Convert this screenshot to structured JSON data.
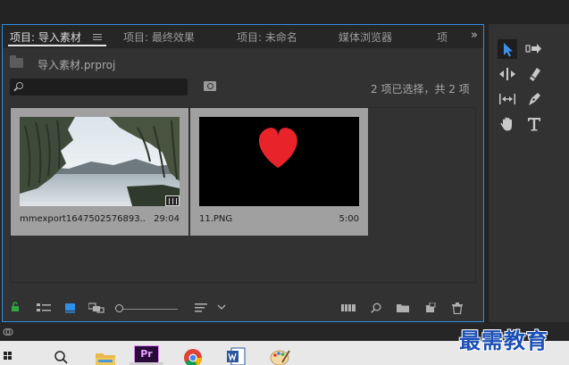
{
  "tabs": [
    {
      "label": "项目: 导入素材",
      "active": true
    },
    {
      "label": "项目: 最终效果",
      "active": false
    },
    {
      "label": "项目: 未命名",
      "active": false
    },
    {
      "label": "媒体浏览器",
      "active": false
    },
    {
      "label": "项",
      "active": false
    }
  ],
  "tabs_overflow": "»",
  "project": {
    "name": "导入素材.prproj"
  },
  "search": {
    "placeholder": ""
  },
  "selection_status": "2 项已选择，共 2 项",
  "items": [
    {
      "name": "mmexport1647502576893...",
      "duration": "29:04",
      "type": "video"
    },
    {
      "name": "11.PNG",
      "duration": "5:00",
      "type": "image"
    }
  ],
  "tools": [
    "selection-tool",
    "track-select-tool",
    "ripple-edit-tool",
    "razor-tool",
    "slip-tool",
    "pen-tool",
    "hand-tool",
    "type-tool"
  ],
  "colors": {
    "accent": "#2f8ee5",
    "heart": "#e8242a",
    "pr_purple": "#e28cf7",
    "watermark": "#1c4fb5"
  },
  "taskbar": [
    "windows-start-icon",
    "search-icon",
    "file-explorer-icon",
    "premiere-pro-icon",
    "chrome-icon",
    "word-icon",
    "paint-icon"
  ],
  "taskbar_pr_label": "Pr",
  "watermark": "最需教育"
}
